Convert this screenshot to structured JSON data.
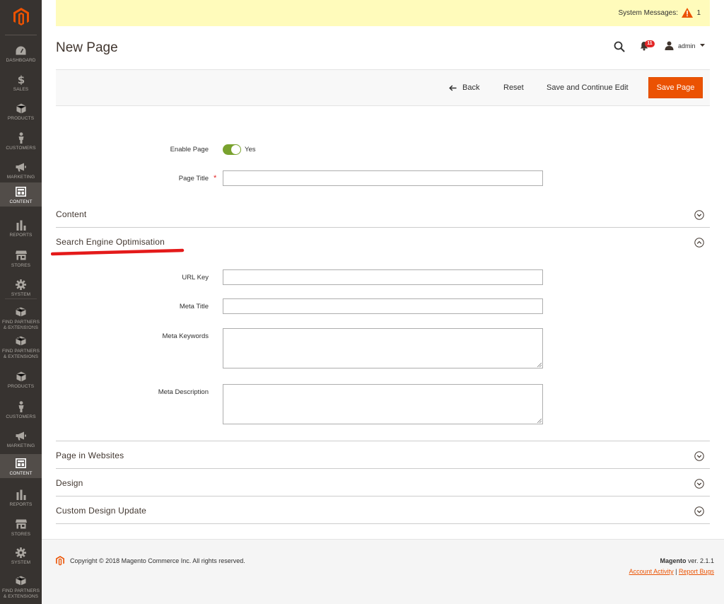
{
  "colors": {
    "sidebar": "#373330",
    "accent": "#eb5202",
    "toggle_on": "#79a22e",
    "sysbar": "#fffbbb",
    "annotation": "#e41a1a"
  },
  "system_messages": {
    "label": "System Messages:",
    "count": "1"
  },
  "header": {
    "title": "New Page",
    "notifications_count": "11",
    "user": "admin"
  },
  "actions": {
    "back": "Back",
    "reset": "Reset",
    "save_continue": "Save and Continue Edit",
    "save": "Save Page"
  },
  "sidebar": {
    "items": [
      {
        "label": "Dashboard",
        "icon": "dashboard-icon"
      },
      {
        "label": "Sales",
        "icon": "dollar-icon"
      },
      {
        "label": "Products",
        "icon": "box-icon"
      },
      {
        "label": "Customers",
        "icon": "person-icon"
      },
      {
        "label": "Marketing",
        "icon": "megaphone-icon"
      },
      {
        "label": "Content",
        "icon": "layout-icon"
      },
      {
        "label": "Reports",
        "icon": "bar-chart-icon"
      },
      {
        "label": "Stores",
        "icon": "store-icon"
      },
      {
        "label": "System",
        "icon": "gear-icon"
      },
      {
        "label": "Find Partners\n& Extensions",
        "icon": "cube-icon"
      },
      {
        "label": "Find Partners\n& Extensions",
        "icon": "cube-icon"
      },
      {
        "label": "Products",
        "icon": "box-icon"
      },
      {
        "label": "Customers",
        "icon": "person-icon"
      },
      {
        "label": "Marketing",
        "icon": "megaphone-icon"
      },
      {
        "label": "Content",
        "icon": "layout-icon"
      },
      {
        "label": "Reports",
        "icon": "bar-chart-icon"
      },
      {
        "label": "Stores",
        "icon": "store-icon"
      },
      {
        "label": "System",
        "icon": "gear-icon"
      },
      {
        "label": "Find Partners\n& Extensions",
        "icon": "cube-icon"
      }
    ]
  },
  "form": {
    "enable_page": {
      "label": "Enable Page",
      "value": "Yes"
    },
    "page_title": {
      "label": "Page Title",
      "required": "*",
      "value": ""
    },
    "sections": {
      "content": "Content",
      "seo": "Search Engine Optimisation",
      "websites": "Page in Websites",
      "design": "Design",
      "custom_design": "Custom Design Update"
    },
    "seo": {
      "url_key": {
        "label": "URL Key",
        "value": ""
      },
      "meta_title": {
        "label": "Meta Title",
        "value": ""
      },
      "meta_keywords": {
        "label": "Meta Keywords",
        "value": ""
      },
      "meta_description": {
        "label": "Meta Description",
        "value": ""
      }
    }
  },
  "footer": {
    "copyright": "Copyright © 2018 Magento Commerce Inc. All rights reserved.",
    "brand": "Magento",
    "version": "ver. 2.1.1",
    "account_activity": "Account Activity",
    "separator": "|",
    "report_bugs": "Report Bugs"
  }
}
